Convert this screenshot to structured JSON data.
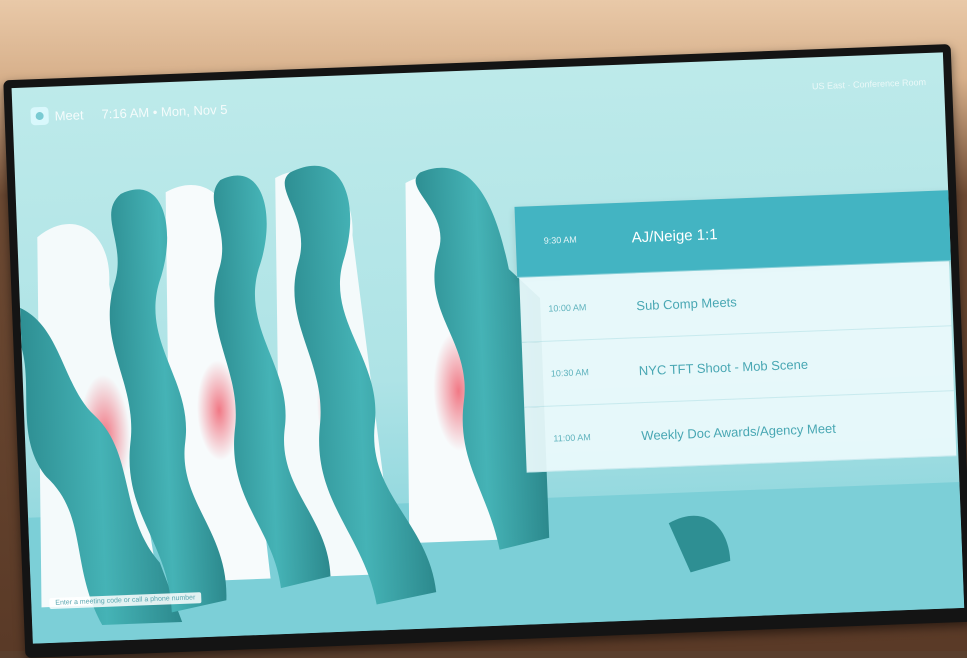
{
  "header": {
    "app_name": "Meet",
    "datetime": "7:16 AM  •  Mon, Nov 5",
    "top_right": "US East · Conference Room"
  },
  "schedule": {
    "items": [
      {
        "time": "9:30 AM",
        "title": "AJ/Neige 1:1",
        "active": true
      },
      {
        "time": "10:00 AM",
        "title": "Sub Comp Meets",
        "active": false
      },
      {
        "time": "10:30 AM",
        "title": "NYC TFT Shoot - Mob Scene",
        "active": false
      },
      {
        "time": "11:00 AM",
        "title": "Weekly Doc Awards/Agency Meet",
        "active": false
      }
    ]
  },
  "footer": {
    "note": "Enter a meeting code or call a phone number"
  },
  "colors": {
    "accent": "#43b4c2",
    "screen_bg": "#aee3e6",
    "wave": "#3fa5ab"
  }
}
